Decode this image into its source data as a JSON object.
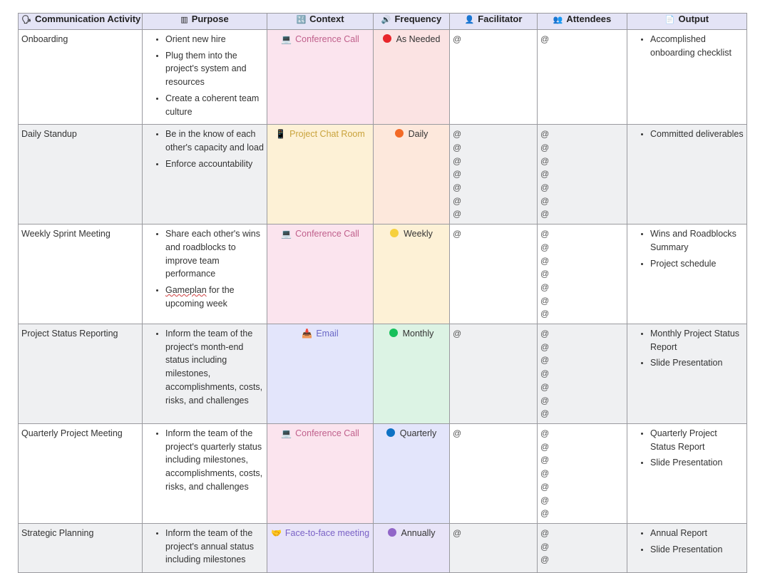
{
  "table": {
    "headers": [
      {
        "label": "Communication Activity",
        "icon": "speech-balloon-icon",
        "glyph": "🗣"
      },
      {
        "label": "Purpose",
        "icon": "archive-icon",
        "glyph": "▥"
      },
      {
        "label": "Context",
        "icon": "symbols-icon",
        "glyph": "🔣"
      },
      {
        "label": "Frequency",
        "icon": "speaker-icon",
        "glyph": "🔊"
      },
      {
        "label": "Facilitator",
        "icon": "person-icon",
        "glyph": "👤"
      },
      {
        "label": "Attendees",
        "icon": "people-icon",
        "glyph": "👥"
      },
      {
        "label": "Output",
        "icon": "document-icon",
        "glyph": "📄"
      }
    ],
    "rows": [
      {
        "activity": "Onboarding",
        "purpose": [
          "Orient new hire",
          "Plug them into the project's system and resources",
          "Create a coherent team culture"
        ],
        "context": {
          "label": "Conference Call",
          "icon": "computer-icon",
          "glyph": "💻",
          "bg": "#fbe4ee",
          "color": "#c0608c"
        },
        "frequency": {
          "label": "As Needed",
          "dot": "#e8262b",
          "bg": "#fbe3e3"
        },
        "facilitator": [
          "@"
        ],
        "attendees": [
          "@"
        ],
        "output": [
          "Accomplished onboarding checklist"
        ]
      },
      {
        "activity": "Daily Standup",
        "purpose": [
          "Be in the know of each other's capacity and load",
          "Enforce accountability"
        ],
        "context": {
          "label": "Project Chat Room",
          "icon": "mobile-phone-icon",
          "glyph": "📱",
          "bg": "#fdf1d6",
          "color": "#c9a33c"
        },
        "frequency": {
          "label": "Daily",
          "dot": "#f36a26",
          "bg": "#fde8dc"
        },
        "facilitator": [
          "@",
          "@",
          "@",
          "@",
          "@",
          "@",
          "@"
        ],
        "attendees": [
          "@",
          "@",
          "@",
          "@",
          "@",
          "@",
          "@"
        ],
        "output": [
          "Committed deliverables"
        ]
      },
      {
        "activity": "Weekly Sprint Meeting",
        "purpose": [
          "Share each other's wins and roadblocks to improve team performance",
          "Gameplan for the upcoming week"
        ],
        "context": {
          "label": "Conference Call",
          "icon": "computer-icon",
          "glyph": "💻",
          "bg": "#fbe4ee",
          "color": "#c0608c"
        },
        "frequency": {
          "label": "Weekly",
          "dot": "#f6d03d",
          "bg": "#fdf1d6"
        },
        "facilitator": [
          "@"
        ],
        "attendees": [
          "@",
          "@",
          "@",
          "@",
          "@",
          "@",
          "@"
        ],
        "output": [
          "Wins and Roadblocks Summary",
          "Project schedule"
        ]
      },
      {
        "activity": "Project Status Reporting",
        "purpose": [
          "Inform the team of the project's month-end status including milestones, accomplishments, costs, risks, and challenges"
        ],
        "context": {
          "label": "Email",
          "icon": "inbox-tray-icon",
          "glyph": "📥",
          "bg": "#e3e5fb",
          "color": "#6a68c6"
        },
        "frequency": {
          "label": "Monthly",
          "dot": "#16c05a",
          "bg": "#dcf3e4"
        },
        "facilitator": [
          "@"
        ],
        "attendees": [
          "@",
          "@",
          "@",
          "@",
          "@",
          "@",
          "@"
        ],
        "output": [
          "Monthly Project Status Report",
          "Slide Presentation"
        ]
      },
      {
        "activity": "Quarterly Project Meeting",
        "purpose": [
          "Inform the team of the project's quarterly status including milestones, accomplishments, costs, risks, and challenges"
        ],
        "context": {
          "label": "Conference Call",
          "icon": "computer-icon",
          "glyph": "💻",
          "bg": "#fbe4ee",
          "color": "#c0608c"
        },
        "frequency": {
          "label": "Quarterly",
          "dot": "#0e72c4",
          "bg": "#e3e5fb"
        },
        "facilitator": [
          "@"
        ],
        "attendees": [
          "@",
          "@",
          "@",
          "@",
          "@",
          "@",
          "@"
        ],
        "output": [
          "Quarterly Project Status Report",
          "Slide Presentation"
        ]
      },
      {
        "activity": "Strategic Planning",
        "purpose": [
          "Inform the team of the project's annual status including milestones"
        ],
        "context": {
          "label": "Face-to-face meeting",
          "icon": "handshake-icon",
          "glyph": "🤝",
          "bg": "#e8e4f8",
          "color": "#7a62c6"
        },
        "frequency": {
          "label": "Annually",
          "dot": "#9166c8",
          "bg": "#e8e4f8"
        },
        "facilitator": [
          "@"
        ],
        "attendees": [
          "@",
          "@",
          "@"
        ],
        "output": [
          "Annual Report",
          "Slide Presentation"
        ]
      }
    ]
  }
}
